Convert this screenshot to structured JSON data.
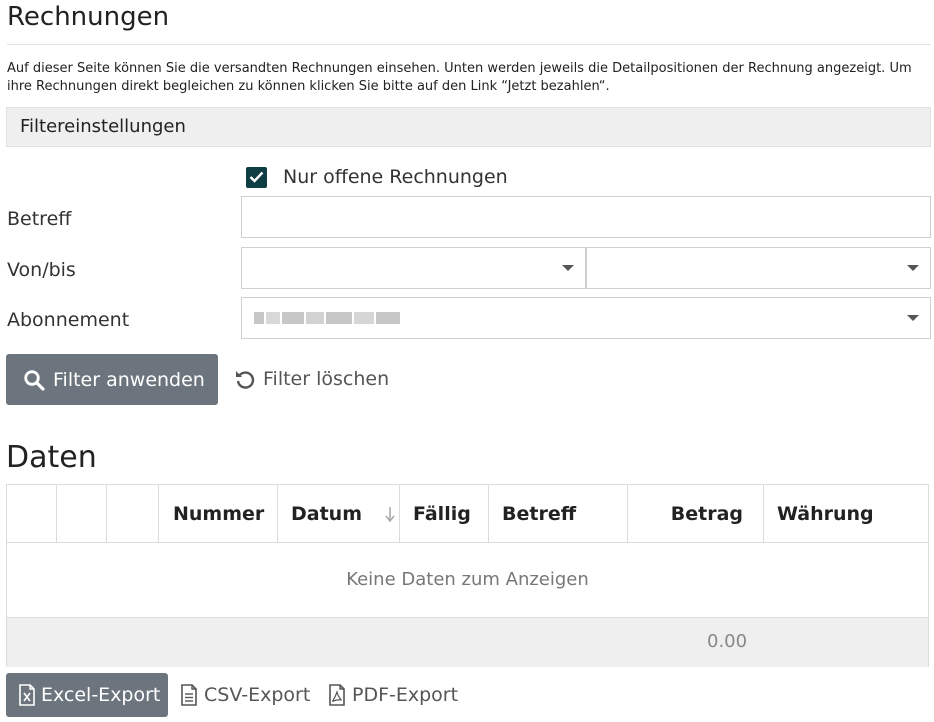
{
  "page": {
    "title": "Rechnungen",
    "intro": "Auf dieser Seite können Sie die versandten Rechnungen einsehen. Unten werden jeweils die Detailpositionen der Rechnung angezeigt. Um ihre Rechnungen direkt begleichen zu können klicken Sie bitte auf den Link “Jetzt bezahlen“."
  },
  "filter": {
    "header": "Filtereinstellungen",
    "only_open_label": "Nur offene Rechnungen",
    "only_open_checked": true,
    "subject_label": "Betreff",
    "subject_value": "",
    "range_label": "Von/bis",
    "from_value": "",
    "to_value": "",
    "subscription_label": "Abonnement",
    "apply_label": "Filter anwenden",
    "clear_label": "Filter löschen",
    "icons": {
      "apply": "search-icon",
      "clear": "undo-icon",
      "dropdown": "chevron-down-icon"
    },
    "accent_color": "#0f3d44"
  },
  "data": {
    "title": "Daten",
    "columns": [
      "",
      "",
      "",
      "Nummer",
      "Datum",
      "Fällig",
      "Betreff",
      "Betrag",
      "Währung"
    ],
    "sort_column": "Datum",
    "empty_message": "Keine Daten zum Anzeigen",
    "total": "0.00"
  },
  "export": {
    "excel_label": "Excel-Export",
    "csv_label": "CSV-Export",
    "pdf_label": "PDF-Export",
    "icons": {
      "excel": "excel-file-icon",
      "csv": "text-file-icon",
      "pdf": "pdf-file-icon"
    },
    "button_color": "#6c757d"
  }
}
